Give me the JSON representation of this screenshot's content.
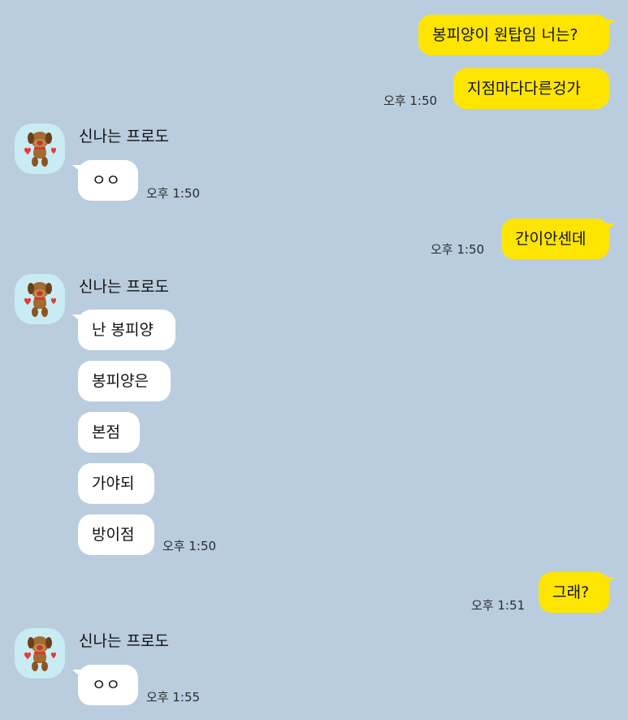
{
  "theme": {
    "background": "#b9cddf",
    "my_bubble_color": "#fee500",
    "their_bubble_color": "#ffffff",
    "avatar_bg": "#c9ecf3"
  },
  "sender_name": "신나는 프로도",
  "avatar_icon": "frodo-dog-character-icon",
  "messages": {
    "m1": "봉피양이 원탑임 너는?",
    "m2": "지점마다다른겅가",
    "t2": "오후 1:50",
    "m3": "ㅇㅇ",
    "t3": "오후 1:50",
    "m4": "간이안센데",
    "t4": "오후 1:50",
    "m5": "난 봉피양",
    "m6": "봉피양은",
    "m7": "본점",
    "m8": "가야되",
    "m9": "방이점",
    "t9": "오후 1:50",
    "m10": "그래?",
    "t10": "오후 1:51",
    "m11": "ㅇㅇ",
    "t11": "오후 1:55"
  }
}
